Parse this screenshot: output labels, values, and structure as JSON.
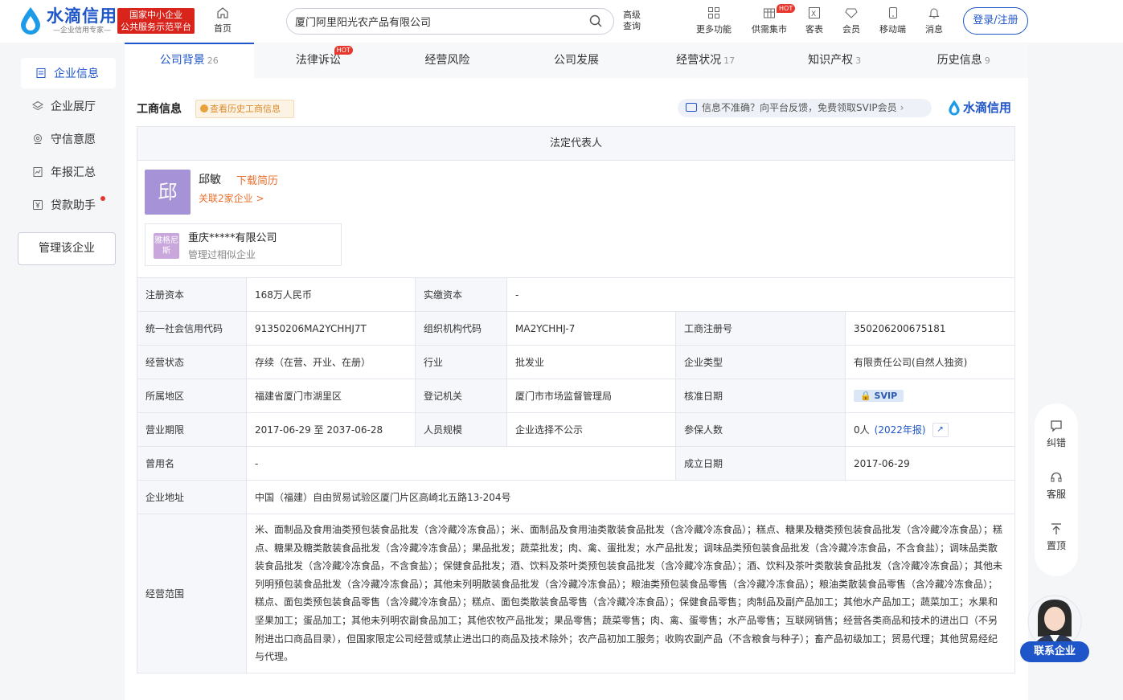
{
  "brand": {
    "name": "水滴信用",
    "slogan": "—企业信用专家—",
    "badge_line1": "国家中小企业",
    "badge_line2": "公共服务示范平台",
    "color": "#1e55c8"
  },
  "header": {
    "home": "首页",
    "search_value": "厦门阿里阳光农产品有限公司",
    "advanced": "高级查询",
    "nav": [
      {
        "label": "更多功能",
        "icon": "grid-icon"
      },
      {
        "label": "供需集市",
        "icon": "market-icon",
        "hot": "HOT"
      },
      {
        "label": "客表",
        "icon": "excel-icon"
      },
      {
        "label": "会员",
        "icon": "diamond-icon"
      },
      {
        "label": "移动端",
        "icon": "mobile-icon"
      },
      {
        "label": "消息",
        "icon": "bell-icon"
      }
    ],
    "login": "登录/注册"
  },
  "sidebar": {
    "items": [
      {
        "label": "企业信息",
        "icon": "document-icon",
        "active": true
      },
      {
        "label": "企业展厅",
        "icon": "layers-icon"
      },
      {
        "label": "守信意愿",
        "icon": "location-icon"
      },
      {
        "label": "年报汇总",
        "icon": "report-icon"
      },
      {
        "label": "贷款助手",
        "icon": "yen-icon",
        "dot": true
      }
    ],
    "manage": "管理该企业"
  },
  "tabs": [
    {
      "label": "公司背景",
      "count": "26",
      "active": true
    },
    {
      "label": "法律诉讼",
      "count": "",
      "hot": "HOT"
    },
    {
      "label": "经营风险",
      "count": ""
    },
    {
      "label": "公司发展",
      "count": ""
    },
    {
      "label": "经营状况",
      "count": "17"
    },
    {
      "label": "知识产权",
      "count": "3"
    },
    {
      "label": "历史信息",
      "count": "9"
    }
  ],
  "section": {
    "title": "工商信息",
    "history_btn": "查看历史工商信息",
    "feedback": "信息不准确？向平台反馈，免费领取SVIP会员",
    "brand": "水滴信用"
  },
  "rep": {
    "header": "法定代表人",
    "avatar_char": "邱",
    "name": "邱敏",
    "download": "下载简历",
    "related": "关联2家企业 >",
    "company_avatar": "雅格尼斯",
    "company": "重庆*****有限公司",
    "company_sub": "管理过相似企业"
  },
  "info": {
    "reg_capital_l": "注册资本",
    "reg_capital": "168万人民币",
    "paid_l": "实缴资本",
    "paid": "-",
    "uscc_l": "统一社会信用代码",
    "uscc": "91350206MA2YCHHJ7T",
    "org_l": "组织机构代码",
    "org": "MA2YCHHJ-7",
    "regno_l": "工商注册号",
    "regno": "350206200675181",
    "status_l": "经营状态",
    "status": "存续（在营、开业、在册）",
    "industry_l": "行业",
    "industry": "批发业",
    "type_l": "企业类型",
    "type": "有限责任公司(自然人独资)",
    "region_l": "所属地区",
    "region": "福建省厦门市湖里区",
    "authority_l": "登记机关",
    "authority": "厦门市市场监督管理局",
    "approve_l": "核准日期",
    "approve": "SVIP",
    "term_l": "营业期限",
    "term": "2017-06-29 至 2037-06-28",
    "staff_l": "人员规模",
    "staff": "企业选择不公示",
    "insured_l": "参保人数",
    "insured": "0人",
    "insured_year": "(2022年报)",
    "former_l": "曾用名",
    "former": "-",
    "founded_l": "成立日期",
    "founded": "2017-06-29",
    "address_l": "企业地址",
    "address": "中国（福建）自由贸易试验区厦门片区高崎北五路13-204号",
    "scope_l": "经营范围",
    "scope": "米、面制品及食用油类预包装食品批发（含冷藏冷冻食品）；米、面制品及食用油类散装食品批发（含冷藏冷冻食品）；糕点、糖果及糖类预包装食品批发（含冷藏冷冻食品）；糕点、糖果及糖类散装食品批发（含冷藏冷冻食品）；果品批发；蔬菜批发；肉、禽、蛋批发；水产品批发；调味品类预包装食品批发（含冷藏冷冻食品，不含食盐）；调味品类散装食品批发（含冷藏冷冻食品，不含食盐）；保健食品批发；酒、饮料及茶叶类预包装食品批发（含冷藏冷冻食品）；酒、饮料及茶叶类散装食品批发（含冷藏冷冻食品）；其他未列明预包装食品批发（含冷藏冷冻食品）；其他未列明散装食品批发（含冷藏冷冻食品）；粮油类预包装食品零售（含冷藏冷冻食品）；粮油类散装食品零售（含冷藏冷冻食品）；糕点、面包类预包装食品零售（含冷藏冷冻食品）；糕点、面包类散装食品零售（含冷藏冷冻食品）；保健食品零售；肉制品及副产品加工；其他水产品加工；蔬菜加工；水果和坚果加工；蛋品加工；其他未列明农副食品加工；其他农牧产品批发；果品零售；蔬菜零售；肉、禽、蛋零售；水产品零售；互联网销售；经营各类商品和技术的进出口（不另附进出口商品目录），但国家限定公司经营或禁止进出口的商品及技术除外；农产品初加工服务；收购农副产品（不含粮食与种子）；畜产品初级加工；贸易代理；其他贸易经纪与代理。"
  },
  "float": {
    "correct": "纠错",
    "service": "客服",
    "top": "置顶",
    "contact": "联系企业"
  }
}
